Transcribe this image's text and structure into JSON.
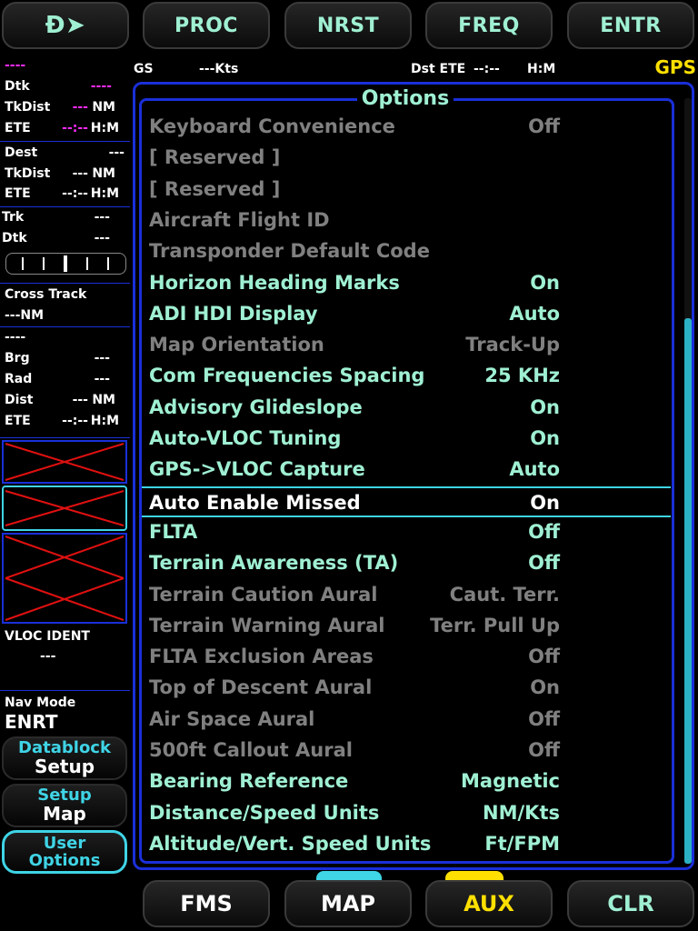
{
  "top_buttons": {
    "direct_to": "Đ➤",
    "proc": "PROC",
    "nrst": "NRST",
    "freq": "FREQ",
    "entr": "ENTR"
  },
  "header": {
    "gs_label": "GS",
    "gs_value": "---Kts",
    "dst_ete_label": "Dst ETE",
    "dst_ete_value": "--:--",
    "hm": "H:M",
    "mode": "GPS"
  },
  "left": {
    "wpt": {
      "name": "----",
      "dtk_label": "Dtk",
      "dtk_value": "----",
      "tkdist_label": "TkDist",
      "tkdist_dash": "---",
      "tkdist_unit": "NM",
      "ete_label": "ETE",
      "ete_dash": "--:--",
      "ete_unit": "H:M"
    },
    "dest": {
      "label": "Dest",
      "value": "---",
      "tkdist_label": "TkDist",
      "tkdist_dash": "---",
      "tkdist_unit": "NM",
      "ete_label": "ETE",
      "ete_dash": "--:--",
      "ete_unit": "H:M"
    },
    "track": {
      "trk_label": "Trk",
      "trk_value": "---",
      "dtk_label": "Dtk",
      "dtk_value": "---"
    },
    "cross_track": {
      "label": "Cross Track",
      "value": "---NM"
    },
    "ref": {
      "name": "----",
      "brg_label": "Brg",
      "brg_value": "---",
      "rad_label": "Rad",
      "rad_value": "---",
      "dist_label": "Dist",
      "dist_dash": "---",
      "dist_unit": "NM",
      "ete_label": "ETE",
      "ete_dash": "--:--",
      "ete_unit": "H:M"
    },
    "vloc": {
      "label": "VLOC IDENT",
      "value": "---"
    },
    "nav_mode": {
      "label": "Nav Mode",
      "value": "ENRT"
    },
    "buttons": [
      {
        "line1": "Datablock",
        "line2": "Setup"
      },
      {
        "line1": "Setup",
        "line2": "Map"
      },
      {
        "line1": "User",
        "line2": "Options"
      }
    ]
  },
  "options": {
    "title": "Options",
    "selected_index": 12,
    "rows": [
      {
        "name": "Keyboard Convenience",
        "value": "Off",
        "enabled": false
      },
      {
        "name": "[ Reserved ]",
        "value": "",
        "enabled": false
      },
      {
        "name": "[ Reserved ]",
        "value": "",
        "enabled": false
      },
      {
        "name": "Aircraft Flight ID",
        "value": "",
        "enabled": false
      },
      {
        "name": "Transponder Default Code",
        "value": "",
        "enabled": false
      },
      {
        "name": "Horizon Heading Marks",
        "value": "On",
        "enabled": true
      },
      {
        "name": "ADI HDI Display",
        "value": "Auto",
        "enabled": true
      },
      {
        "name": "Map Orientation",
        "value": "Track-Up",
        "enabled": false
      },
      {
        "name": "Com Frequencies Spacing",
        "value": "25 KHz",
        "enabled": true
      },
      {
        "name": "Advisory Glideslope",
        "value": "On",
        "enabled": true
      },
      {
        "name": "Auto-VLOC Tuning",
        "value": "On",
        "enabled": true
      },
      {
        "name": "GPS->VLOC Capture",
        "value": "Auto",
        "enabled": true
      },
      {
        "name": "Auto Enable Missed",
        "value": "On",
        "enabled": true
      },
      {
        "name": "FLTA",
        "value": "Off",
        "enabled": true
      },
      {
        "name": "Terrain Awareness (TA)",
        "value": "Off",
        "enabled": true
      },
      {
        "name": "Terrain Caution Aural",
        "value": "Caut. Terr.",
        "enabled": false
      },
      {
        "name": "Terrain Warning Aural",
        "value": "Terr. Pull Up",
        "enabled": false
      },
      {
        "name": "FLTA Exclusion Areas",
        "value": "Off",
        "enabled": false
      },
      {
        "name": "Top of Descent Aural",
        "value": "On",
        "enabled": false
      },
      {
        "name": "Air Space Aural",
        "value": "Off",
        "enabled": false
      },
      {
        "name": "500ft Callout Aural",
        "value": "Off",
        "enabled": false
      },
      {
        "name": "Bearing Reference",
        "value": "Magnetic",
        "enabled": true
      },
      {
        "name": "Distance/Speed Units",
        "value": "NM/Kts",
        "enabled": true
      },
      {
        "name": "Altitude/Vert. Speed Units",
        "value": "Ft/FPM",
        "enabled": true
      }
    ]
  },
  "bottom_buttons": {
    "fms": "FMS",
    "map": "MAP",
    "aux": "AUX",
    "clr": "CLR"
  },
  "colors": {
    "accent": "#9ff0d2",
    "frame_blue": "#1a2fd8",
    "magenta": "#ff2bff",
    "yellow": "#ffe000",
    "cyan": "#3fd4e6",
    "disabled": "#808080"
  }
}
